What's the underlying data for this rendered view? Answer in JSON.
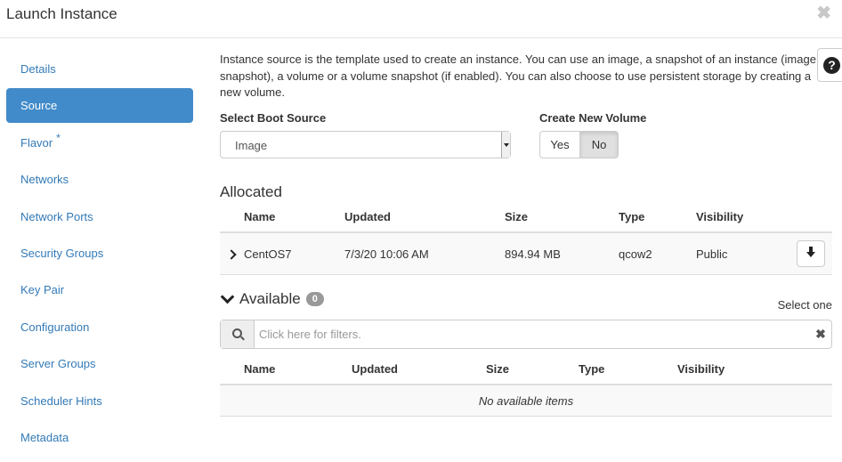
{
  "modal": {
    "title": "Launch Instance",
    "close_symbol": "✖"
  },
  "nav": {
    "items": [
      {
        "label": "Details",
        "active": false
      },
      {
        "label": "Source",
        "active": true
      },
      {
        "label": "Flavor",
        "active": false,
        "required": true
      },
      {
        "label": "Networks",
        "active": false
      },
      {
        "label": "Network Ports",
        "active": false
      },
      {
        "label": "Security Groups",
        "active": false
      },
      {
        "label": "Key Pair",
        "active": false
      },
      {
        "label": "Configuration",
        "active": false
      },
      {
        "label": "Server Groups",
        "active": false
      },
      {
        "label": "Scheduler Hints",
        "active": false
      },
      {
        "label": "Metadata",
        "active": false
      }
    ],
    "required_marker": "*"
  },
  "help": {
    "symbol": "?"
  },
  "source": {
    "description": "Instance source is the template used to create an instance. You can use an image, a snapshot of an instance (image snapshot), a volume or a volume snapshot (if enabled). You can also choose to use persistent storage by creating a new volume.",
    "boot_source_label": "Select Boot Source",
    "boot_source_value": "Image",
    "create_volume_label": "Create New Volume",
    "yes_label": "Yes",
    "no_label": "No",
    "selected_volume_option": "No"
  },
  "allocated": {
    "title": "Allocated",
    "columns": [
      "Name",
      "Updated",
      "Size",
      "Type",
      "Visibility"
    ],
    "rows": [
      {
        "name": "CentOS7",
        "updated": "7/3/20 10:06 AM",
        "size": "894.94 MB",
        "type": "qcow2",
        "visibility": "Public"
      }
    ]
  },
  "available": {
    "title": "Available",
    "count": "0",
    "select_hint": "Select one",
    "filter_placeholder": "Click here for filters.",
    "clear_symbol": "✖",
    "columns": [
      "Name",
      "Updated",
      "Size",
      "Type",
      "Visibility"
    ],
    "empty_text": "No available items"
  },
  "colors": {
    "accent": "#428bca",
    "link": "#337ab7"
  }
}
